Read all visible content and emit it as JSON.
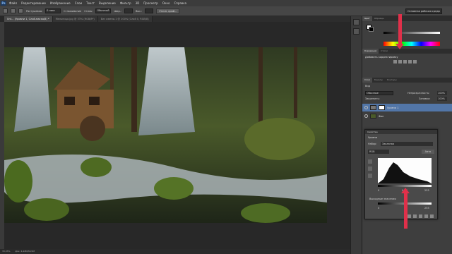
{
  "menu": {
    "items": [
      "Файл",
      "Редактирование",
      "Изображение",
      "Слои",
      "Текст",
      "Выделение",
      "Фильтр",
      "3D",
      "Просмотр",
      "Окно",
      "Справка"
    ]
  },
  "options": {
    "tool_label": "Растушевка:",
    "feather_value": "0 пикс",
    "antialias_label": "Сглаживание",
    "style_label": "Стиль:",
    "style_value": "Обычный",
    "width_label": "Шир.:",
    "height_label": "Выс.:",
    "refine_button": "Уточн. край...",
    "workspace_value": "Основная рабочая среда"
  },
  "tabs": [
    {
      "label": "Unt... (Уровни 1, Слой-маска/8) *",
      "active": true
    },
    {
      "label": "Мельница.jpg @ 33% (RGB/8*)",
      "active": false
    },
    {
      "label": "Без имени-1 @ 100% (Слой 0, RGB/8)",
      "active": false
    }
  ],
  "status": {
    "zoom": "33,33%",
    "doc": "Док: 4,44M/30,5M"
  },
  "panels": {
    "color_tabs": [
      "Цвет",
      "Образцы"
    ],
    "adjust_tabs": [
      "Коррекция",
      "Стили"
    ],
    "adjust_title": "Добавить корректировку",
    "layer_tabs": [
      "Слои",
      "Каналы",
      "Контуры"
    ],
    "kind_label": "Вид",
    "blend_mode": "Обычные",
    "opacity_label": "Непрозрачность:",
    "opacity_value": "100%",
    "lock_label": "Закрепить:",
    "fill_label": "Заливка:",
    "fill_value": "100%",
    "layers": [
      {
        "name": "Уровни 1",
        "selected": true
      },
      {
        "name": "Фон",
        "selected": false
      }
    ]
  },
  "properties": {
    "title": "Свойства",
    "adjust_name": "Уровни",
    "preset_label": "Набор:",
    "preset_value": "Заказная",
    "channel_value": "RGB",
    "auto_button": "Авто",
    "input_low": "0",
    "input_mid": "0,67",
    "input_high": "255",
    "output_label": "Выходные значения:",
    "output_low": "0",
    "output_high": "255"
  },
  "colors": {
    "accent_arrow": "#e0304a",
    "panel_bg": "#3e3e3e"
  }
}
